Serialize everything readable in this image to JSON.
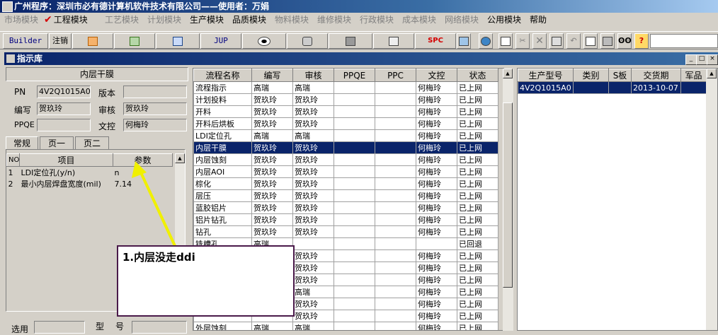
{
  "window": {
    "title": "广州程序：深圳市必有德计算机软件技术有限公司——使用者：万娟"
  },
  "menu": [
    {
      "label": "市场模块",
      "enabled": false
    },
    {
      "label": "工程模块",
      "enabled": true,
      "checked": true
    },
    {
      "label": "工艺模块",
      "enabled": false
    },
    {
      "label": "计划模块",
      "enabled": false
    },
    {
      "label": "生产模块",
      "enabled": true
    },
    {
      "label": "品质模块",
      "enabled": true
    },
    {
      "label": "物料模块",
      "enabled": false
    },
    {
      "label": "维修模块",
      "enabled": false
    },
    {
      "label": "行政模块",
      "enabled": false
    },
    {
      "label": "成本模块",
      "enabled": false
    },
    {
      "label": "网络模块",
      "enabled": false
    },
    {
      "label": "公用模块",
      "enabled": true
    },
    {
      "label": "帮助",
      "enabled": true
    }
  ],
  "toolbar": {
    "builder": "Builder",
    "logout": "注销",
    "jup": "JUP",
    "spc": "SPC",
    "icons": [
      "ppt-icon",
      "excel-icon",
      "word-icon",
      "jup-icon",
      "eye-icon",
      "database-icon",
      "network-icon",
      "spc-icon",
      "table-icon",
      "ie-icon",
      "new-icon",
      "cut-icon",
      "delete-icon",
      "save-icon",
      "undo-icon",
      "preview-icon",
      "print-icon",
      "find-icon",
      "help-icon"
    ]
  },
  "inner_window": {
    "title": "指示库"
  },
  "left_panel": {
    "title": "内层干膜",
    "pn_label": "PN",
    "pn_value": "4V2Q1015A0",
    "version_label": "版本",
    "version_value": "",
    "author_label": "编写",
    "author_value": "贺玖玲",
    "review_label": "审核",
    "review_value": "贺玖玲",
    "ppqe_label": "PPQE",
    "ppqe_value": "",
    "doc_label": "文控",
    "doc_value": "何梅玲",
    "tabs": [
      "常规",
      "页一",
      "页二"
    ],
    "param_headers": [
      "NO",
      "项目",
      "参数"
    ],
    "params": [
      {
        "no": "1",
        "item": "LDI定位孔(y/n)",
        "value": "n"
      },
      {
        "no": "2",
        "item": "最小内层焊盘宽度(mil)",
        "value": "7.14"
      }
    ],
    "bottom_labels": [
      "选用",
      "型",
      "号"
    ]
  },
  "flow_table": {
    "headers": [
      "流程名称",
      "编写",
      "审核",
      "PPQE",
      "PPC",
      "文控",
      "状态"
    ],
    "rows": [
      [
        "流程指示",
        "高瑞",
        "高瑞",
        "",
        "",
        "何梅玲",
        "已上网"
      ],
      [
        "计划投料",
        "贺玖玲",
        "贺玖玲",
        "",
        "",
        "何梅玲",
        "已上网"
      ],
      [
        "开料",
        "贺玖玲",
        "贺玖玲",
        "",
        "",
        "何梅玲",
        "已上网"
      ],
      [
        "开料后烘板",
        "贺玖玲",
        "贺玖玲",
        "",
        "",
        "何梅玲",
        "已上网"
      ],
      [
        "LDI定位孔",
        "高瑞",
        "高瑞",
        "",
        "",
        "何梅玲",
        "已上网"
      ],
      [
        "内层干膜",
        "贺玖玲",
        "贺玖玲",
        "",
        "",
        "何梅玲",
        "已上网"
      ],
      [
        "内层蚀刻",
        "贺玖玲",
        "贺玖玲",
        "",
        "",
        "何梅玲",
        "已上网"
      ],
      [
        "内层AOI",
        "贺玖玲",
        "贺玖玲",
        "",
        "",
        "何梅玲",
        "已上网"
      ],
      [
        "棕化",
        "贺玖玲",
        "贺玖玲",
        "",
        "",
        "何梅玲",
        "已上网"
      ],
      [
        "层压",
        "贺玖玲",
        "贺玖玲",
        "",
        "",
        "何梅玲",
        "已上网"
      ],
      [
        "蓝胶铝片",
        "贺玖玲",
        "贺玖玲",
        "",
        "",
        "何梅玲",
        "已上网"
      ],
      [
        "铝片钻孔",
        "贺玖玲",
        "贺玖玲",
        "",
        "",
        "何梅玲",
        "已上网"
      ],
      [
        "钻孔",
        "贺玖玲",
        "贺玖玲",
        "",
        "",
        "何梅玲",
        "已上网"
      ],
      [
        "铣槽孔",
        "高瑞",
        "",
        "",
        "",
        "",
        "已回退"
      ],
      [
        "",
        "",
        "贺玖玲",
        "",
        "",
        "何梅玲",
        "已上网"
      ],
      [
        "",
        "",
        "贺玖玲",
        "",
        "",
        "何梅玲",
        "已上网"
      ],
      [
        "",
        "",
        "贺玖玲",
        "",
        "",
        "何梅玲",
        "已上网"
      ],
      [
        "",
        "",
        "高瑞",
        "",
        "",
        "何梅玲",
        "已上网"
      ],
      [
        "",
        "",
        "贺玖玲",
        "",
        "",
        "何梅玲",
        "已上网"
      ],
      [
        "",
        "",
        "贺玖玲",
        "",
        "",
        "何梅玲",
        "已上网"
      ],
      [
        "外层蚀刻",
        "高瑞",
        "高瑞",
        "",
        "",
        "何梅玲",
        "已上网"
      ]
    ],
    "selected_index": 5
  },
  "order_table": {
    "headers": [
      "生产型号",
      "类别",
      "S板",
      "交货期",
      "军品"
    ],
    "rows": [
      [
        "4V2Q1015A0",
        "",
        "",
        "2013-10-07",
        ""
      ]
    ]
  },
  "annotation": {
    "text": "1.内层没走ddi"
  },
  "colors": {
    "selection": "#0a246a",
    "annotation_arrow": "#f0f000",
    "callout_border": "#4a1a4a"
  }
}
